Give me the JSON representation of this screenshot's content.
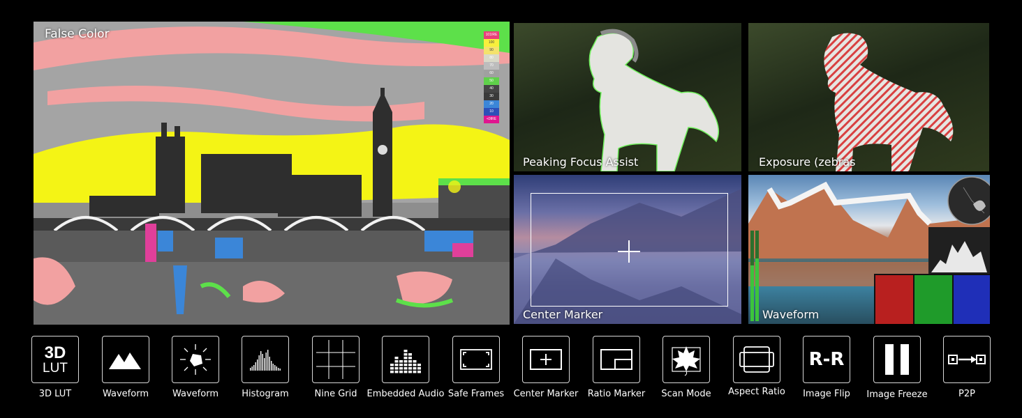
{
  "panels": {
    "false_color": "False Color",
    "peaking": "Peaking Focus Assist",
    "zebras": "Exposure (zebras",
    "center_marker": "Center Marker",
    "waveform": "Waveform"
  },
  "false_color_scale": [
    "101IRE",
    "100",
    "90",
    "80",
    "70",
    "60",
    "50",
    "40",
    "30",
    "20",
    "10",
    "<0IRE"
  ],
  "false_color_colors": [
    "#e8407a",
    "#f7ef3c",
    "#f4e26c",
    "#d9d9c8",
    "#bdbdbd",
    "#a0a0a0",
    "#5fd14a",
    "#454545",
    "#3a3a3a",
    "#3b86d8",
    "#2d4fb8",
    "#e0158f"
  ],
  "tools": [
    {
      "label": "3D LUT",
      "icon": "3d-lut-icon",
      "text1": "3D",
      "text2": "LUT"
    },
    {
      "label": "Waveform",
      "icon": "mountain-waveform-icon"
    },
    {
      "label": "Waveform",
      "icon": "vectorscope-icon"
    },
    {
      "label": "Histogram",
      "icon": "histogram-icon"
    },
    {
      "label": "Nine Grid",
      "icon": "nine-grid-icon"
    },
    {
      "label": "Embedded Audio",
      "icon": "audio-meter-icon"
    },
    {
      "label": "Safe Frames",
      "icon": "safe-frames-icon"
    },
    {
      "label": "Center Marker",
      "icon": "center-marker-icon"
    },
    {
      "label": "Ratio Marker",
      "icon": "ratio-marker-icon"
    },
    {
      "label": "Scan Mode",
      "icon": "scan-mode-icon"
    },
    {
      "label": "Aspect Ratio",
      "icon": "aspect-ratio-icon"
    },
    {
      "label": "Image Flip",
      "icon": "image-flip-icon",
      "text": "R-R"
    },
    {
      "label": "Image Freeze",
      "icon": "image-freeze-icon"
    },
    {
      "label": "P2P",
      "icon": "p2p-icon"
    }
  ]
}
